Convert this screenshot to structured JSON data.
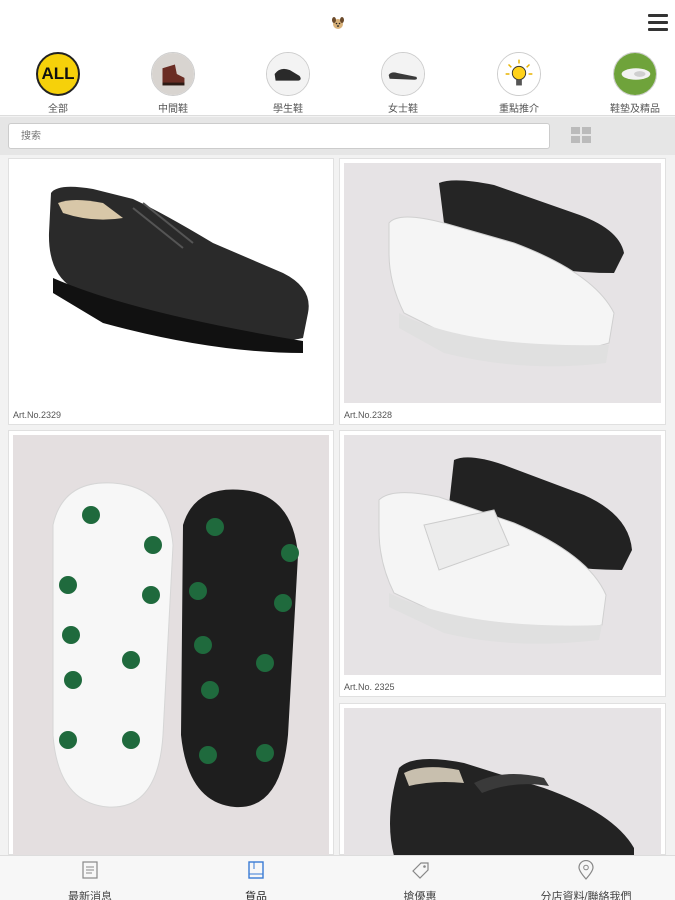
{
  "categories": [
    {
      "label": "全部",
      "icon": "all-badge-icon",
      "badge": "ALL"
    },
    {
      "label": "中間鞋",
      "icon": "brown-shoe-icon"
    },
    {
      "label": "學生鞋",
      "icon": "black-shoe-icon"
    },
    {
      "label": "女士鞋",
      "icon": "ladies-shoe-icon"
    },
    {
      "label": "重點推介",
      "icon": "lightbulb-icon"
    },
    {
      "label": "鞋墊及精品",
      "icon": "insole-icon"
    }
  ],
  "search": {
    "placeholder": "搜索"
  },
  "products": [
    {
      "caption": "Art.No.2329"
    },
    {
      "caption": "Art.No.2328"
    },
    {
      "caption": ""
    },
    {
      "caption": "Art.No. 2325"
    },
    {
      "caption": ""
    }
  ],
  "bottom_nav": [
    {
      "label": "最新消息",
      "icon": "news-icon"
    },
    {
      "label": "貨品",
      "icon": "products-icon"
    },
    {
      "label": "搶優惠",
      "icon": "tag-icon"
    },
    {
      "label": "分店資料/聯絡我們",
      "icon": "location-pin-icon"
    }
  ]
}
